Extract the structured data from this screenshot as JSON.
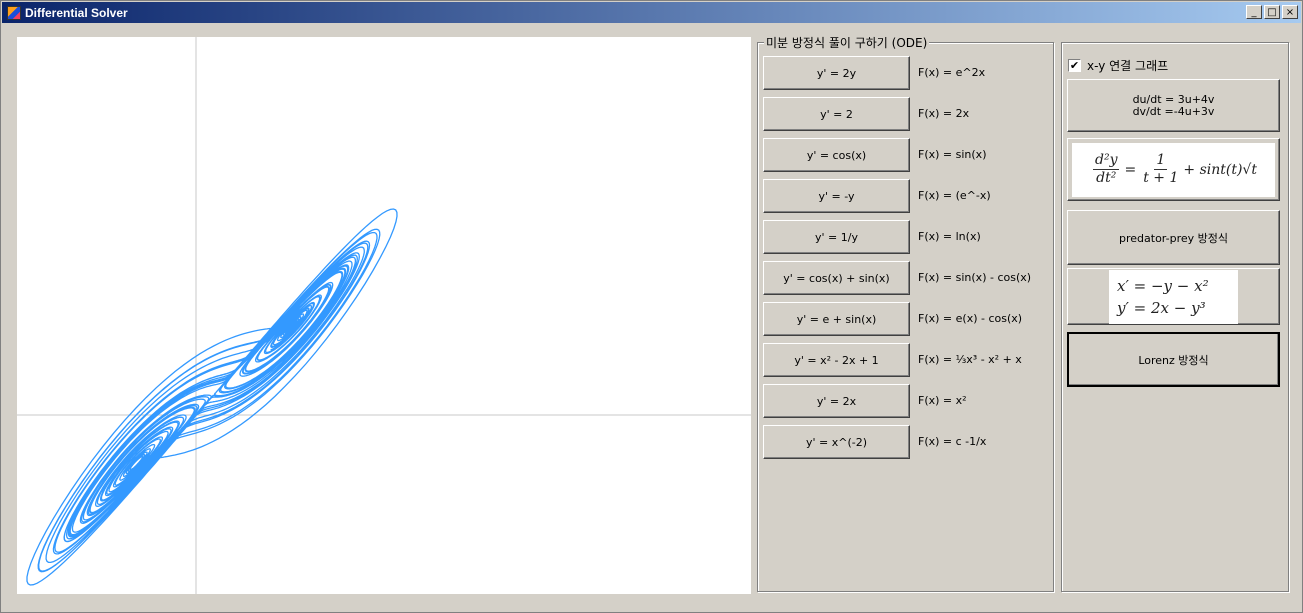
{
  "window": {
    "title": "Differential Solver",
    "controls": [
      "_",
      "□",
      "×"
    ]
  },
  "plot": {
    "description_series_color": "#3399ff",
    "axes_color": "#c8c8c8",
    "x_range": [
      -5,
      15
    ],
    "y_range": [
      -5,
      15
    ]
  },
  "ode_panel": {
    "legend": "미분 방정식 풀이 구하기 (ODE)",
    "items": [
      {
        "button": "y' = 2y",
        "solution": "F(x) = e^2x"
      },
      {
        "button": "y'  =  2",
        "solution": "F(x) = 2x"
      },
      {
        "button": "y'  =  cos(x)",
        "solution": "F(x) = sin(x)"
      },
      {
        "button": "y'  =  -y",
        "solution": "F(x) = (e^-x)"
      },
      {
        "button": "y'  =  1/y",
        "solution": "F(x) = ln(x)"
      },
      {
        "button": "y'  =  cos(x) + sin(x)",
        "solution": "F(x) = sin(x) - cos(x)"
      },
      {
        "button": "y'  =  e  + sin(x)",
        "solution": "F(x) = e(x) - cos(x)"
      },
      {
        "button": "y' = x² - 2x + 1",
        "solution": "F(x) = ⅓x³ - x² + x"
      },
      {
        "button": "y' = 2x",
        "solution": "F(x) = x²"
      },
      {
        "button": "y' = x^(-2)",
        "solution": "F(x) = c -1/x"
      }
    ]
  },
  "right_panel": {
    "checkbox_label": "x-y 연결 그래프",
    "checkbox_checked": "✔",
    "system_button": {
      "line1": "du/dt = 3u+4v",
      "line2": "dv/dt =-4u+3v"
    },
    "formula1": {
      "lhs_num": "d²y",
      "lhs_den": "dt²",
      "eq": "=",
      "rhs_num": "1",
      "rhs_den": "t + 1",
      "tail": "+ sint(t)√t"
    },
    "predator_prey_label": "predator-prey 방정식",
    "formula2": {
      "line1": "x′ =   −y − x²",
      "line2": "y′ =   2x − y³"
    },
    "lorenz_label": "Lorenz 방정식"
  }
}
